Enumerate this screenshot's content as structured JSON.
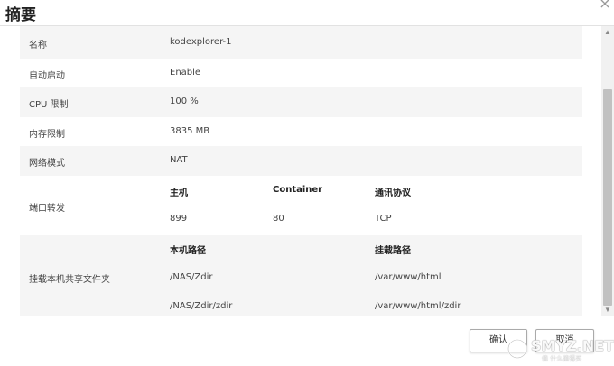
{
  "dialog": {
    "title": "摘要",
    "close_glyph": "×"
  },
  "summary": {
    "rows": [
      {
        "label": "名称",
        "value": "kodexplorer-1"
      },
      {
        "label": "自动启动",
        "value": "Enable"
      },
      {
        "label": "CPU 限制",
        "value": "100 %"
      },
      {
        "label": "内存限制",
        "value": "3835 MB"
      },
      {
        "label": "网络模式",
        "value": "NAT"
      }
    ],
    "port_forwarding": {
      "label": "端口转发",
      "headers": [
        "主机",
        "Container",
        "通讯协议"
      ],
      "rows": [
        [
          "899",
          "80",
          "TCP"
        ]
      ]
    },
    "shared_folders": {
      "label": "挂载本机共享文件夹",
      "headers": [
        "本机路径",
        "挂载路径"
      ],
      "rows": [
        [
          "/NAS/Zdir",
          "/var/www/html"
        ],
        [
          "/NAS/Zdir/zdir",
          "/var/www/html/zdir"
        ]
      ]
    }
  },
  "buttons": {
    "ok": "确认",
    "cancel": "取消"
  },
  "watermark": {
    "text": "SMYZ.NET",
    "sub": "值 什么值得买"
  },
  "icons": {
    "close": "close-icon",
    "scroll_up": "scroll-up-arrow-icon",
    "scroll_down": "scroll-down-arrow-icon"
  }
}
